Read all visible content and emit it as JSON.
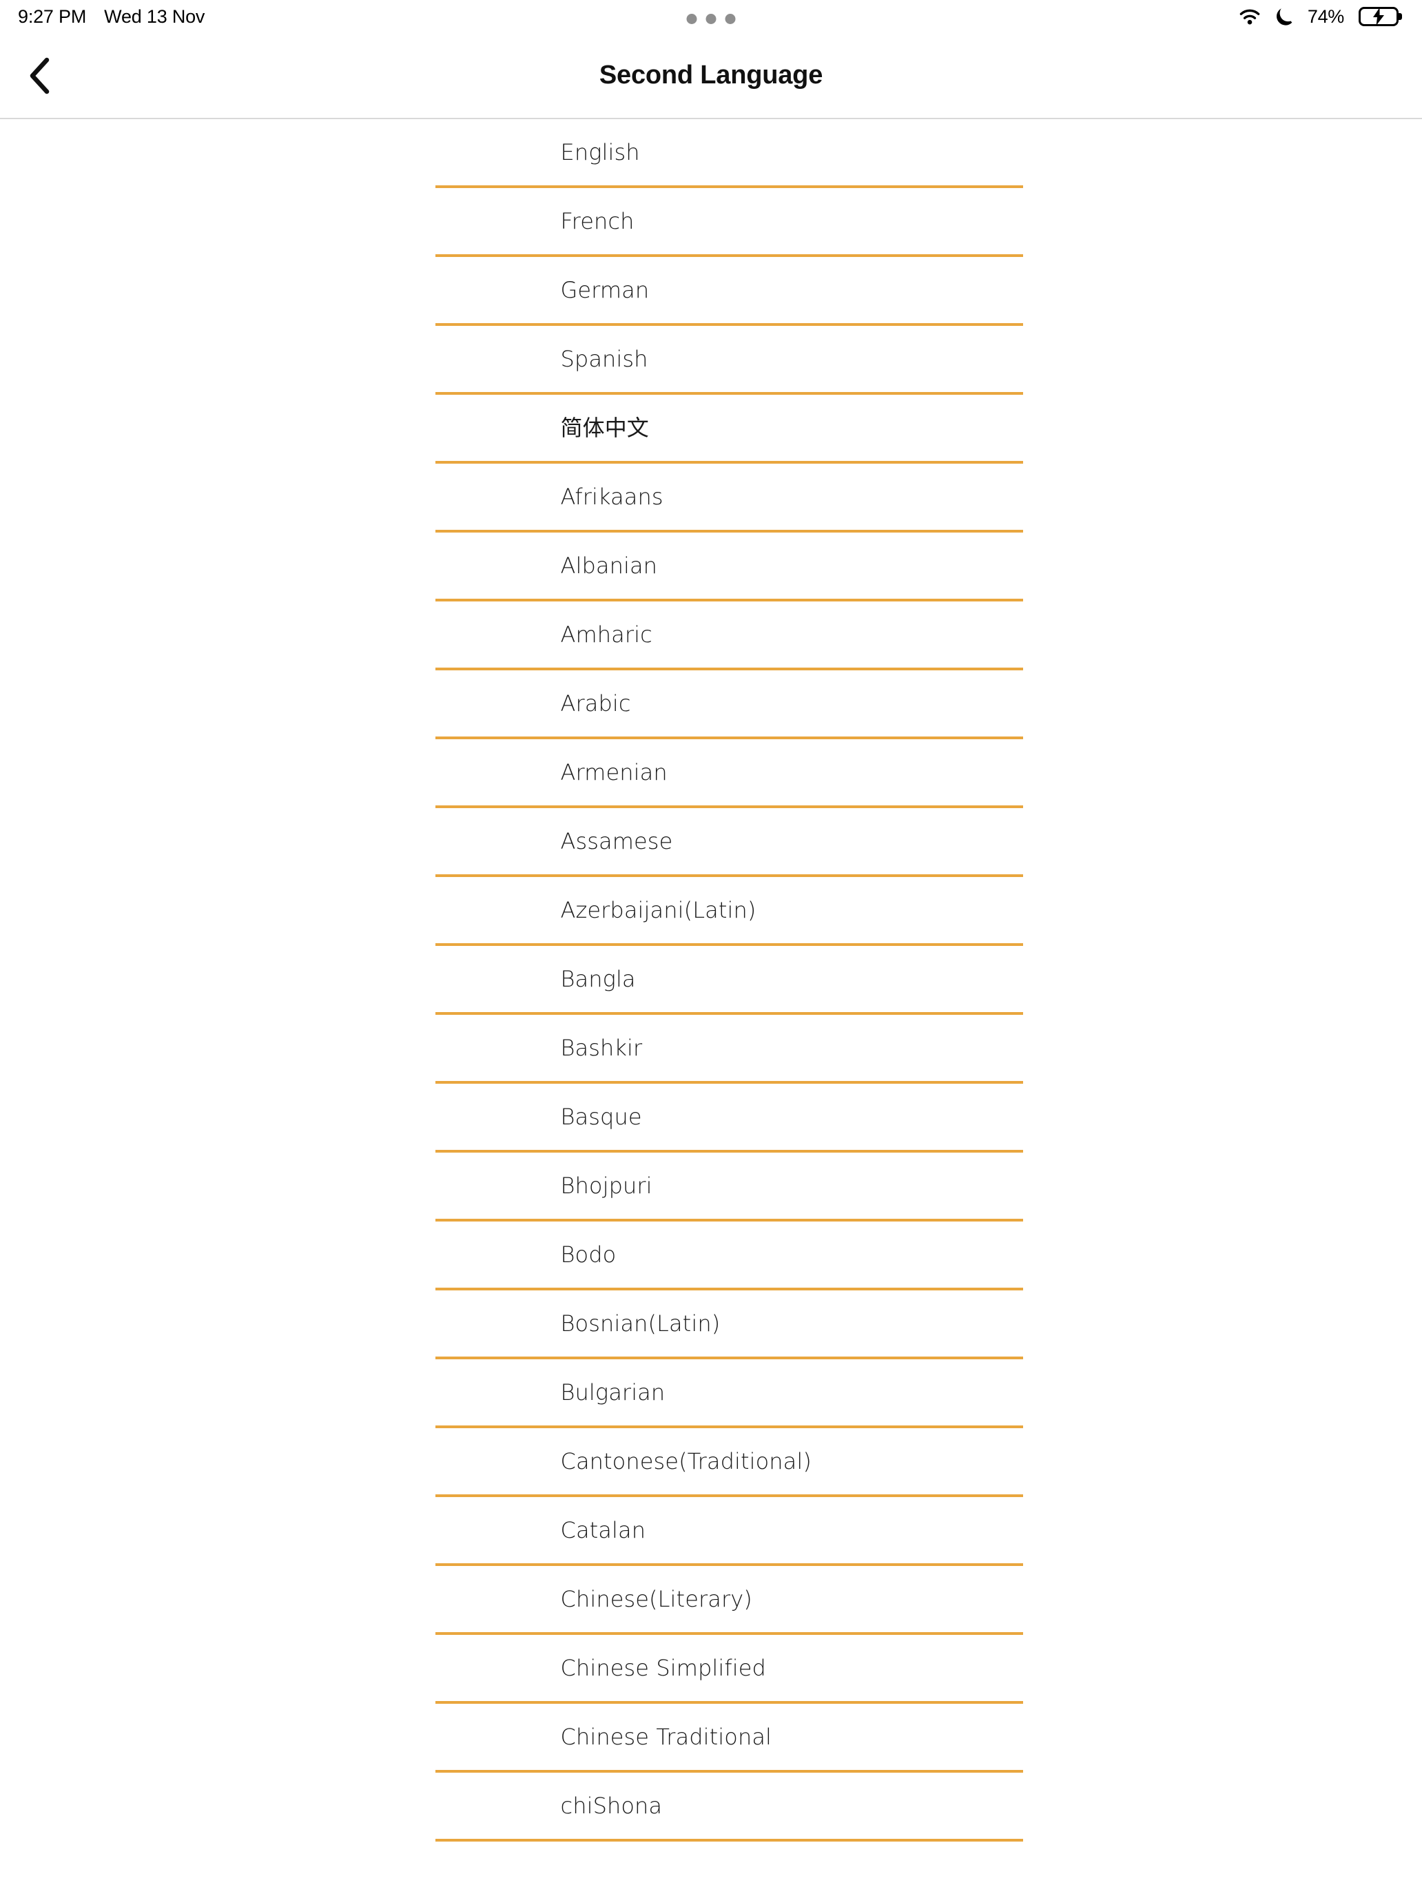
{
  "status_bar": {
    "time": "9:27 PM",
    "date": "Wed 13 Nov",
    "battery_percent": "74%",
    "icons": [
      "wifi-icon",
      "moon-icon",
      "battery-charging-icon"
    ],
    "multitask_dots": 3
  },
  "header": {
    "title": "Second Language",
    "back_label": "Back"
  },
  "theme": {
    "separator_color": "#E9A63E",
    "header_border_color": "#D8D8D8",
    "background": "#FFFFFF",
    "text_color": "#1A1A1A",
    "battery_fill": "#30D158"
  },
  "language_list": {
    "items": [
      {
        "label": "English"
      },
      {
        "label": "French"
      },
      {
        "label": "German"
      },
      {
        "label": "Spanish"
      },
      {
        "label": "简体中文"
      },
      {
        "label": "Afrikaans"
      },
      {
        "label": "Albanian"
      },
      {
        "label": "Amharic"
      },
      {
        "label": "Arabic"
      },
      {
        "label": "Armenian"
      },
      {
        "label": "Assamese"
      },
      {
        "label": "Azerbaijani(Latin)"
      },
      {
        "label": "Bangla"
      },
      {
        "label": "Bashkir"
      },
      {
        "label": "Basque"
      },
      {
        "label": "Bhojpuri"
      },
      {
        "label": "Bodo"
      },
      {
        "label": "Bosnian(Latin)"
      },
      {
        "label": "Bulgarian"
      },
      {
        "label": "Cantonese(Traditional)"
      },
      {
        "label": "Catalan"
      },
      {
        "label": "Chinese(Literary)"
      },
      {
        "label": "Chinese Simplified"
      },
      {
        "label": "Chinese Traditional"
      },
      {
        "label": "chiShona"
      }
    ]
  }
}
